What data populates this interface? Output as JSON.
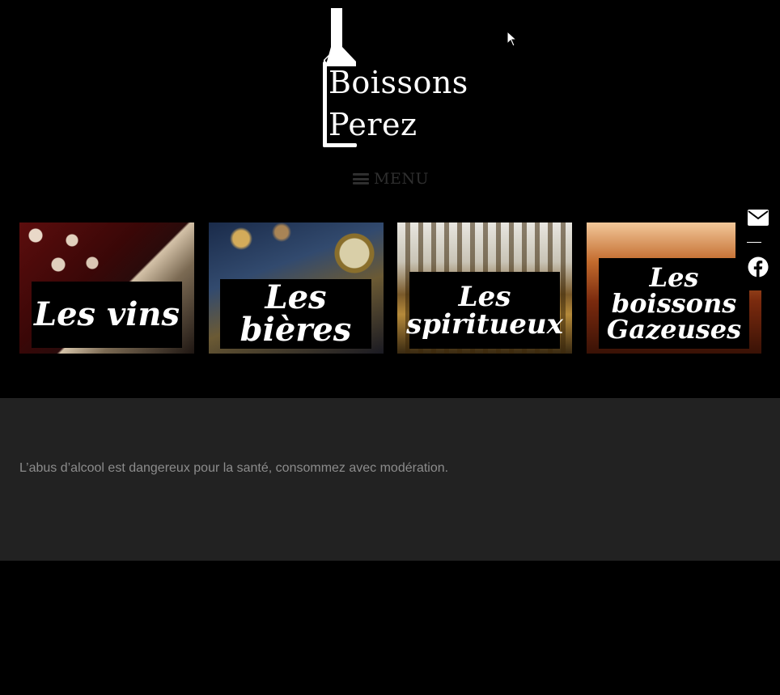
{
  "brand": {
    "name_line1": "Boissons",
    "name_line2": "Perez"
  },
  "nav": {
    "menu_label": "MENU",
    "menu_icon": "hamburger-icon"
  },
  "categories": [
    {
      "label": "Les vins"
    },
    {
      "label": "Les bières"
    },
    {
      "label": "Les spiritueux"
    },
    {
      "label": "Les boissons Gazeuses"
    }
  ],
  "social": {
    "mail_icon": "envelope-icon",
    "facebook_icon": "facebook-icon"
  },
  "footer": {
    "warning": "L’abus d’alcool est dangereux pour la santé, consommez avec modération."
  },
  "colors": {
    "background": "#000000",
    "footer_background": "#222222",
    "footer_text": "#8c8c8c",
    "menu_text": "#2f2f2f"
  }
}
